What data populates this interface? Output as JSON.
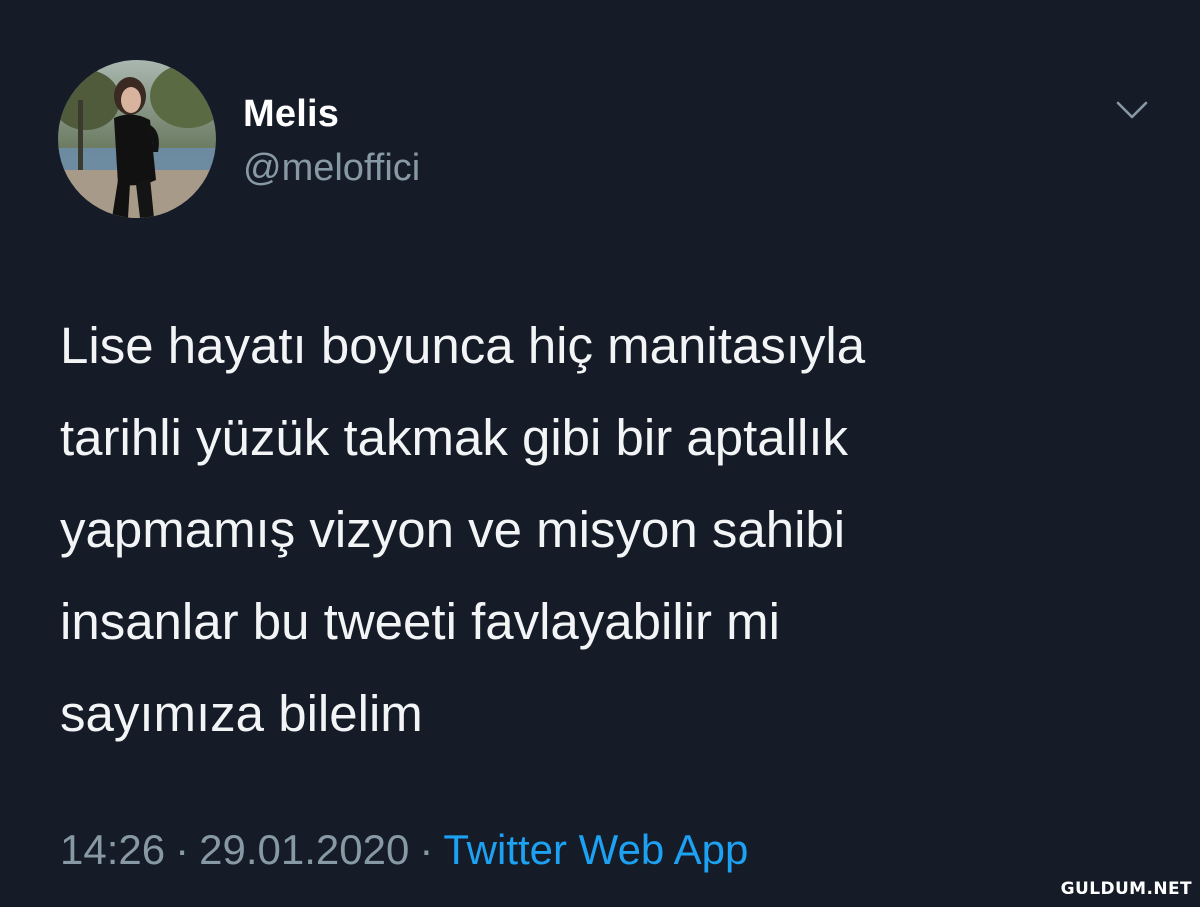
{
  "tweet": {
    "author": {
      "name": "Melis",
      "handle": "@meloffici"
    },
    "text": "Lise hayatı boyunca hiç manitasıyla\ntarihli yüzük takmak gibi bir aptallık\nyapmamış vizyon ve misyon sahibi\ninsanlar bu tweeti favlayabilir mi\nsayımıza bilelim",
    "time": "14:26",
    "separator": "·",
    "date": "29.01.2020",
    "source": "Twitter Web App"
  },
  "icons": {
    "menu": "chevron-down-icon",
    "avatar": "profile-photo"
  },
  "colors": {
    "background": "#151c27",
    "text": "#ffffff",
    "muted": "#8899a6",
    "link": "#1da1f2"
  },
  "watermark": "GULDUM.NET"
}
